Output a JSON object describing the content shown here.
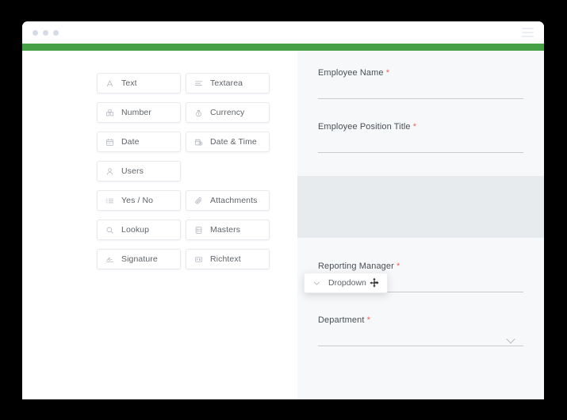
{
  "window": {
    "traffic_lights": [
      "dot-1",
      "dot-2",
      "dot-3"
    ],
    "menu_icon": "hamburger-menu-icon",
    "accent_color": "#46a045"
  },
  "palette": {
    "fields": [
      {
        "label": "Text",
        "icon": "letter-a-icon"
      },
      {
        "label": "Textarea",
        "icon": "text-lines-icon"
      },
      {
        "label": "Number",
        "icon": "number-grid-icon"
      },
      {
        "label": "Currency",
        "icon": "money-bag-icon"
      },
      {
        "label": "Date",
        "icon": "calendar-icon"
      },
      {
        "label": "Date & Time",
        "icon": "calendar-clock-icon"
      },
      {
        "label": "Users",
        "icon": "user-icon"
      },
      {
        "label": "",
        "icon": ""
      },
      {
        "label": "Yes / No",
        "icon": "checklist-icon"
      },
      {
        "label": "Attachments",
        "icon": "paperclip-icon"
      },
      {
        "label": "Lookup",
        "icon": "magnifier-icon"
      },
      {
        "label": "Masters",
        "icon": "database-icon"
      },
      {
        "label": "Signature",
        "icon": "signature-pen-icon"
      },
      {
        "label": "Richtext",
        "icon": "richtext-box-icon"
      }
    ]
  },
  "drag": {
    "label": "Dropdown",
    "icon": "chevron-down-icon",
    "cursor": "move-cursor"
  },
  "form": {
    "required_marker": "*",
    "fields": [
      {
        "label": "Employee Name",
        "required": true,
        "has_caret": false
      },
      {
        "label": "Employee Position Title",
        "required": true,
        "has_caret": false
      },
      {
        "label": "Reporting Manager",
        "required": true,
        "has_caret": false
      },
      {
        "label": "Department",
        "required": true,
        "has_caret": true
      }
    ]
  }
}
